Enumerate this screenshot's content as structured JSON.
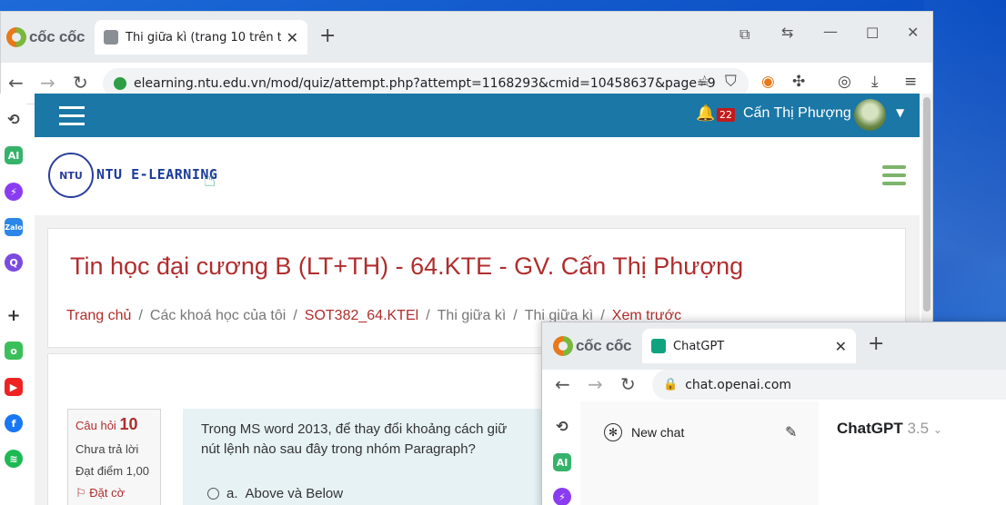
{
  "browser1": {
    "brand": "cốc cốc",
    "tab_title": "Thi giữa kì (trang 10 trên tổng",
    "url": "elearning.ntu.edu.vn/mod/quiz/attempt.php?attempt=1168293&cmid=10458637&page=9"
  },
  "site": {
    "notification_count": "22",
    "user_name": "Cấn Thị Phượng",
    "logo_text": "NTU",
    "brand_name": "NTU E-LEARNING"
  },
  "course": {
    "title": "Tin học đại cương B (LT+TH) - 64.KTE - GV. Cấn Thị Phượng",
    "breadcrumb": [
      "Trang chủ",
      "Các khoá học của tôi",
      "SOT382_64.KTEl",
      "Thi giữa kì",
      "Thi giữa kì",
      "Xem trước"
    ]
  },
  "question": {
    "label": "Câu hỏi",
    "number": "10",
    "status": "Chưa trả lời",
    "score": "Đạt điểm 1,00",
    "flag": "Đặt cờ",
    "text_line1": "Trong MS word 2013, để thay đổi khoảng cách giữ",
    "text_line2": "nút lệnh nào sau đây trong nhóm Paragraph?",
    "option_a_letter": "a.",
    "option_a_text": "Above và Below"
  },
  "browser2": {
    "brand": "cốc cốc",
    "tab_title": "ChatGPT",
    "url": "chat.openai.com",
    "new_chat": "New chat",
    "model_name": "ChatGPT",
    "model_version": "3.5"
  },
  "colors": {
    "navbar": "#1a77a6",
    "accent_red": "#b02d2d",
    "question_bg": "#e7f2f5"
  }
}
